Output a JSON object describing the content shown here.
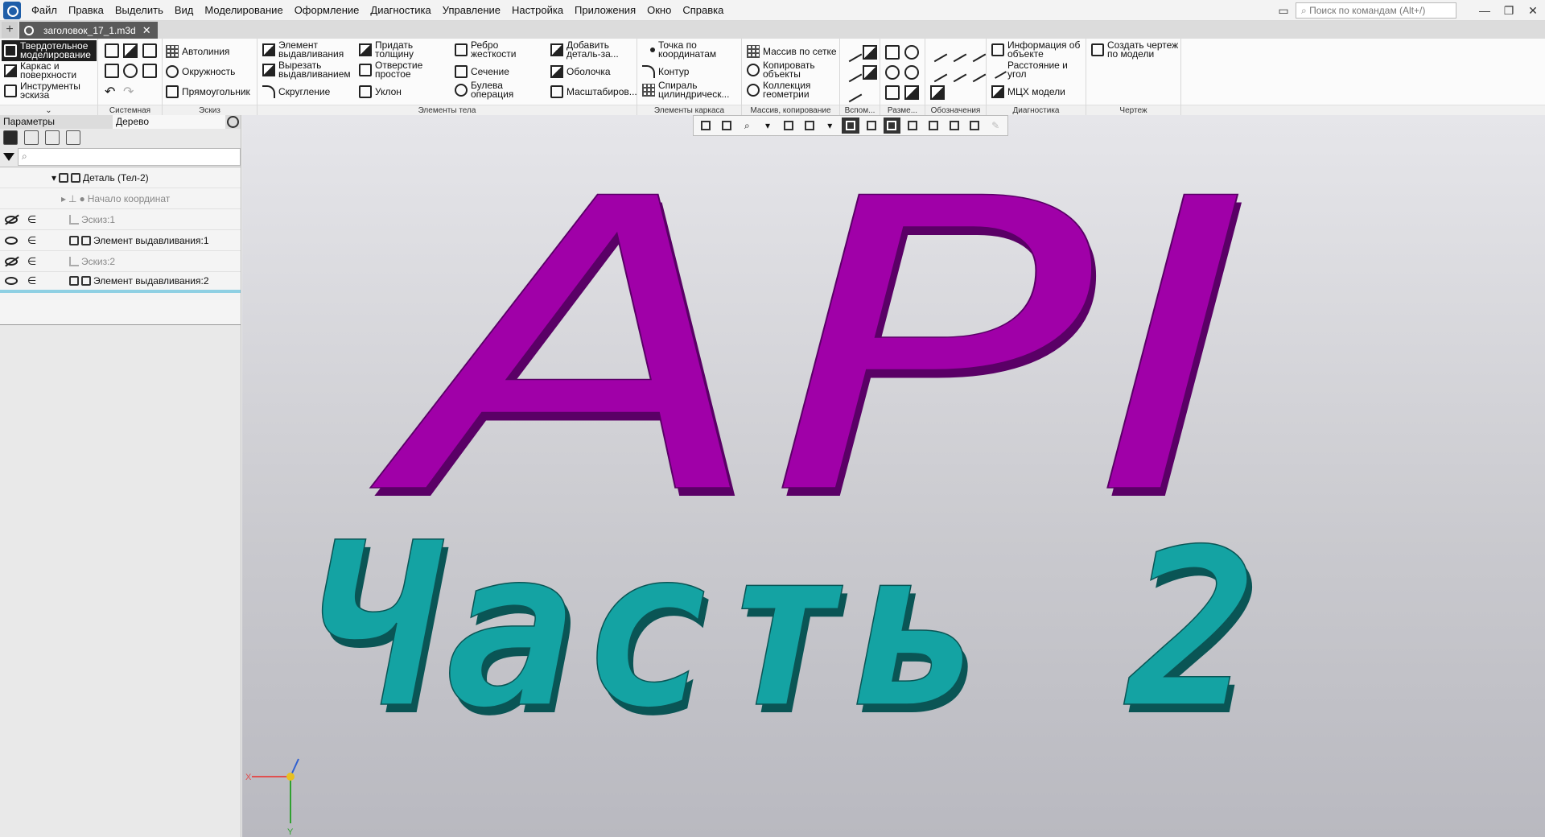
{
  "menubar": {
    "items": [
      "Файл",
      "Правка",
      "Выделить",
      "Вид",
      "Моделирование",
      "Оформление",
      "Диагностика",
      "Управление",
      "Настройка",
      "Приложения",
      "Окно",
      "Справка"
    ],
    "search_placeholder": "Поиск по командам (Alt+/)"
  },
  "tabbar": {
    "doc_tab": "заголовок_17_1.m3d",
    "close": "✕",
    "add": "+"
  },
  "modes": [
    "Твердотельное моделирование",
    "Каркас и поверхности",
    "Инструменты эскиза"
  ],
  "toolbar": {
    "sketch": [
      "Автолиния",
      "Окружность",
      "Прямоугольник"
    ],
    "body": [
      "Элемент выдавливания",
      "Вырезать выдавливанием",
      "Скругление",
      "Придать толщину",
      "Отверстие простое",
      "Уклон",
      "Ребро жесткости",
      "Сечение",
      "Булева операция",
      "Добавить деталь-за...",
      "Оболочка",
      "Масштабиров..."
    ],
    "frame": [
      "Точка по координатам",
      "Контур",
      "Спираль цилиндрическ..."
    ],
    "array": [
      "Массив по сетке",
      "Копировать объекты",
      "Коллекция геометрии"
    ],
    "diag": [
      "Информация об объекте",
      "Расстояние и угол",
      "МЦХ модели"
    ],
    "drawing": [
      "Создать чертеж по модели"
    ],
    "group_labels": [
      "Системная",
      "Эскиз",
      "Элементы тела",
      "Элементы каркаса",
      "Массив, копирование",
      "Вспом...",
      "Разме...",
      "Обозначения",
      "Диагностика",
      "Чертеж"
    ]
  },
  "panel": {
    "tabs": [
      "Параметры",
      "Дерево"
    ],
    "tree": [
      {
        "label": "Деталь (Тел-2)"
      },
      {
        "label": "Начало координат"
      },
      {
        "label": "Эскиз:1"
      },
      {
        "label": "Элемент выдавливания:1"
      },
      {
        "label": "Эскиз:2"
      },
      {
        "label": "Элемент выдавливания:2"
      }
    ]
  },
  "scene": {
    "text_line1": "API",
    "text_line2": "Часть 2",
    "color_line1": "#a000a8",
    "color_line1_side": "#5a0066",
    "color_line2": "#14a3a3",
    "color_line2_side": "#0a5555",
    "axis_x": "X",
    "axis_y": "Y"
  }
}
